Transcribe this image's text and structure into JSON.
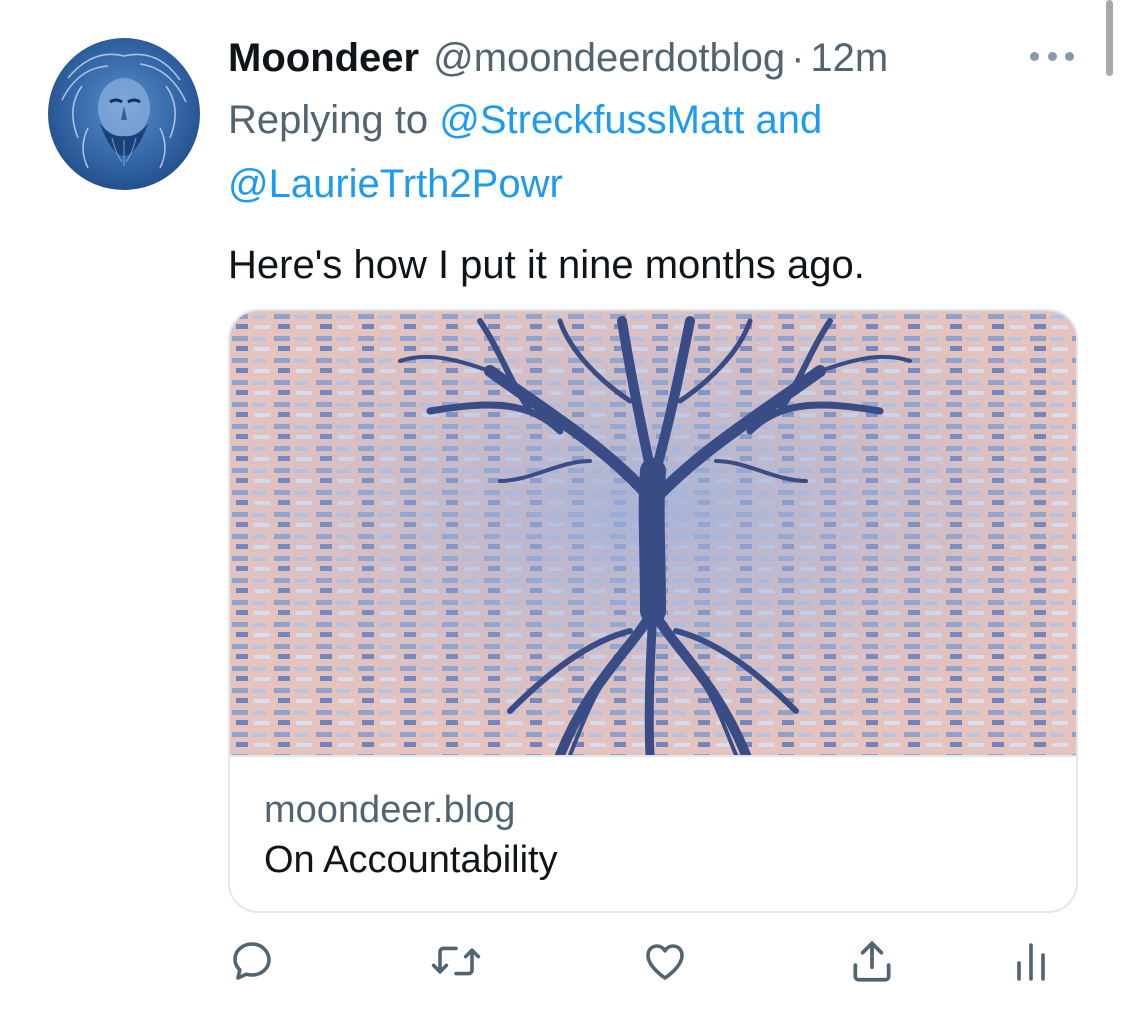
{
  "tweet": {
    "display_name": "Moondeer",
    "handle": "@moondeerdotblog",
    "separator": "·",
    "time": "12m",
    "reply_prefix": "Replying to",
    "reply_mentions": [
      "@StreckfussMatt",
      "@LaurieTrth2Powr"
    ],
    "reply_conjunction": "and",
    "text": "Here's how I put it nine months ago."
  },
  "link_card": {
    "domain": "moondeer.blog",
    "title": "On Accountability"
  },
  "actions": {
    "icons": [
      "reply-icon",
      "retweet-icon",
      "like-icon",
      "share-icon",
      "analytics-icon"
    ]
  },
  "colors": {
    "link": "#1d9bf0",
    "secondary_text": "#536471",
    "primary_text": "#0f1419",
    "border": "#e1e8ed",
    "avatar_blue": "#3a6fb0",
    "tree_navy": "#2e3f78",
    "card_pink": "#e9b9b3",
    "card_blue": "#8ea3cf"
  }
}
